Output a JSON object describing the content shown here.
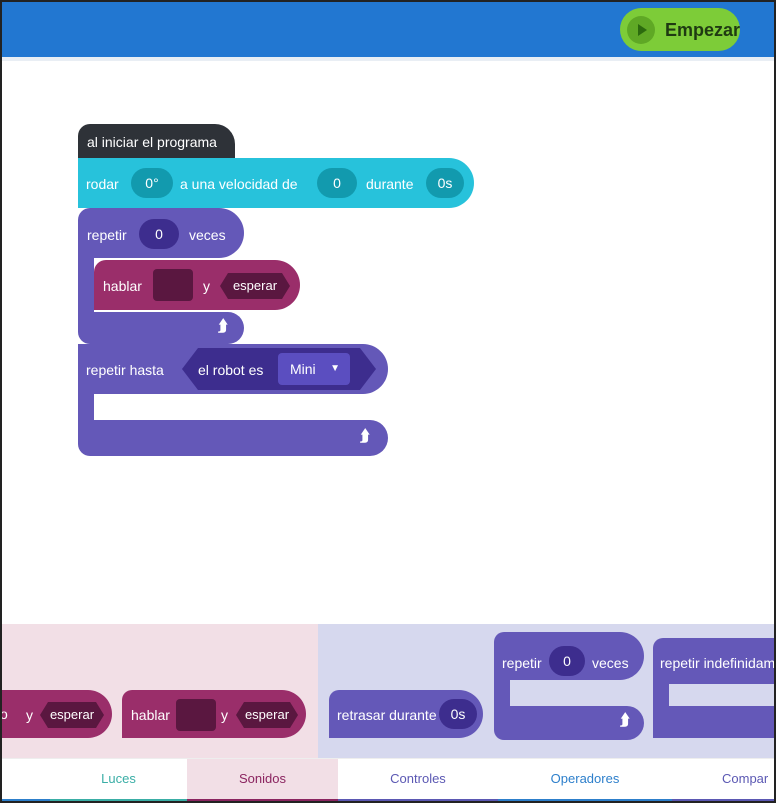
{
  "toolbar": {
    "start_label": "Empezar"
  },
  "canvas": {
    "start_block": "al iniciar el programa",
    "roll": {
      "label": "rodar",
      "angle": "0°",
      "speed_label": "a una velocidad de",
      "speed": "0",
      "duration_label": "durante",
      "duration": "0s"
    },
    "repeat": {
      "label": "repetir",
      "count": "0",
      "times_label": "veces"
    },
    "speak": {
      "label": "hablar",
      "and_label": "y",
      "wait_label": "esperar"
    },
    "repeat_until": {
      "label": "repetir hasta",
      "condition_label": "el robot es",
      "condition_value": "Mini"
    }
  },
  "palette": {
    "speak_partial": {
      "and_label": "y",
      "wait_label": "esperar"
    },
    "speak": {
      "label": "hablar",
      "and_label": "y",
      "wait_label": "esperar"
    },
    "delay": {
      "label": "retrasar durante",
      "value": "0s"
    },
    "repeat": {
      "label": "repetir",
      "count": "0",
      "times_label": "veces"
    },
    "repeat_forever": {
      "label": "repetir indefinidam"
    }
  },
  "tabs": [
    {
      "label": "Luces",
      "color": "#3aaea6"
    },
    {
      "label": "Sonidos",
      "color": "#8b2560"
    },
    {
      "label": "Controles",
      "color": "#5b58b3"
    },
    {
      "label": "Operadores",
      "color": "#2d7fcb"
    },
    {
      "label": "Compar",
      "color": "#5b58b3"
    }
  ],
  "colors": {
    "header": "#2277d1",
    "start_button": "#7dcc38",
    "movement": "#27c2db",
    "control": "#6458b8",
    "sound": "#9a2e6a",
    "event": "#2e3238"
  }
}
